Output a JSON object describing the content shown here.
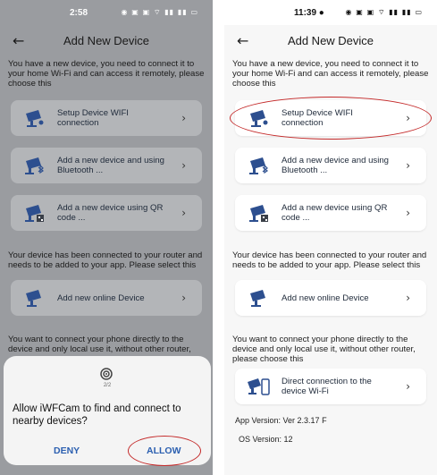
{
  "left": {
    "status": {
      "time": "2:58",
      "icons": "◉ ▣ ▣ ⌔ ▮▮ ▮▮ ▭"
    },
    "appbar": {
      "title": "Add New Device"
    },
    "intro": "You have a new device, you need to connect it to your home Wi-Fi and can access it remotely, please choose this",
    "cards": [
      {
        "label": "Setup Device WIFI connection",
        "icon": "camera-wifi-icon"
      },
      {
        "label": "Add a new device and using Bluetooth ...",
        "icon": "camera-bluetooth-icon"
      },
      {
        "label": "Add a new device using QR code ...",
        "icon": "camera-qr-icon"
      }
    ],
    "router_text": "Your device has been connected to your router and needs to be added to your app. Please select this",
    "online_card": {
      "label": "Add new online Device"
    },
    "direct_text": "You want to connect your phone directly to the device and only local use it, without other router,",
    "dialog": {
      "step": "2/2",
      "message": "Allow iWFCam to find and connect to nearby devices?",
      "deny": "DENY",
      "allow": "ALLOW"
    }
  },
  "right": {
    "status": {
      "time": "11:39 ●",
      "icons": "◉ ▣ ▣ ⌔ ▮▮ ▮▮ ▭"
    },
    "appbar": {
      "title": "Add New Device"
    },
    "intro": "You have a new device, you need to connect it to your home Wi-Fi and can access it remotely, please choose this",
    "cards": [
      {
        "label": "Setup Device WIFI connection",
        "icon": "camera-wifi-icon"
      },
      {
        "label": "Add a new device and using Bluetooth ...",
        "icon": "camera-bluetooth-icon"
      },
      {
        "label": "Add a new device using QR code ...",
        "icon": "camera-qr-icon"
      }
    ],
    "router_text": "Your device has been connected to your router and needs to be added to your app. Please select this",
    "online_card": {
      "label": "Add new online Device"
    },
    "direct_text": "You want to connect your phone directly to the device and only local use it, without other router, please choose this",
    "direct_card": {
      "label": "Direct connection to the device Wi-Fi"
    },
    "app_version": "App Version: Ver 2.3.17 F",
    "os_version": "OS Version: 12"
  },
  "colors": {
    "annotation": "#c42a2a",
    "dialog_button": "#2b5fb0",
    "icon_blue": "#2d4f8f"
  }
}
